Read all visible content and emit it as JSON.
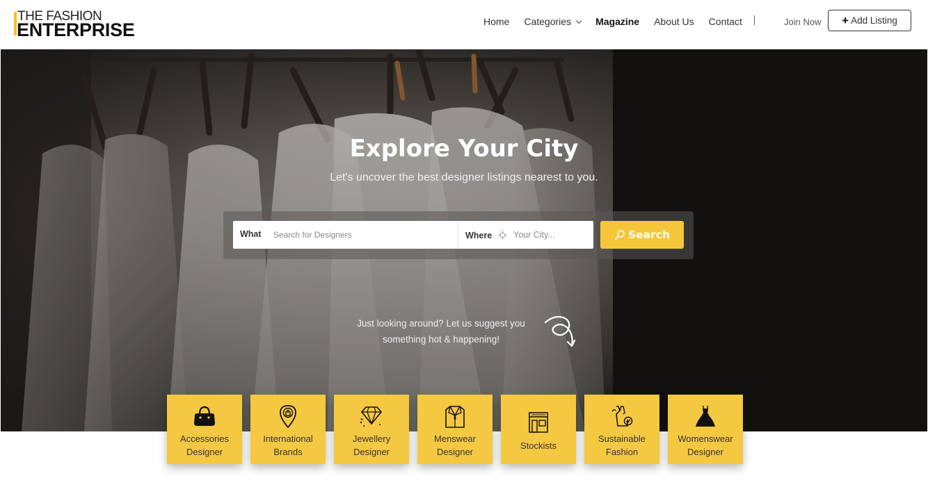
{
  "brand": {
    "line1": "THE FASHION",
    "line2": "ENTERPRISE",
    "accent_color": "#f5c518"
  },
  "nav": {
    "items": [
      {
        "label": "Home"
      },
      {
        "label": "Categories",
        "has_dropdown": true
      },
      {
        "label": "Magazine",
        "active": true
      },
      {
        "label": "About Us"
      },
      {
        "label": "Contact"
      }
    ],
    "join_label": "Join Now",
    "add_listing_label": "Add Listing"
  },
  "hero": {
    "title": "Explore Your City",
    "subtitle": "Let's uncover the best designer listings nearest to you."
  },
  "search": {
    "what_label": "What",
    "what_placeholder": "Search for Designers",
    "where_label": "Where",
    "where_placeholder": "Your City...",
    "button_label": "Search",
    "button_color": "#f5c63a"
  },
  "suggest": {
    "line1": "Just looking around? Let us suggest you",
    "line2": "something hot & happening!"
  },
  "categories": [
    {
      "line1": "Accessories",
      "line2": "Designer",
      "icon": "handbag-icon"
    },
    {
      "line1": "International",
      "line2": "Brands",
      "icon": "map-pin-bag-icon"
    },
    {
      "line1": "Jewellery",
      "line2": "Designer",
      "icon": "diamond-icon"
    },
    {
      "line1": "Menswear",
      "line2": "Designer",
      "icon": "suit-icon"
    },
    {
      "line1": "Stockists",
      "line2": "",
      "icon": "storefront-icon"
    },
    {
      "line1": "Sustainable",
      "line2": "Fashion",
      "icon": "eco-dress-icon"
    },
    {
      "line1": "Womenswear",
      "line2": "Designer",
      "icon": "gown-icon"
    }
  ],
  "tile_color": "#f5c842"
}
